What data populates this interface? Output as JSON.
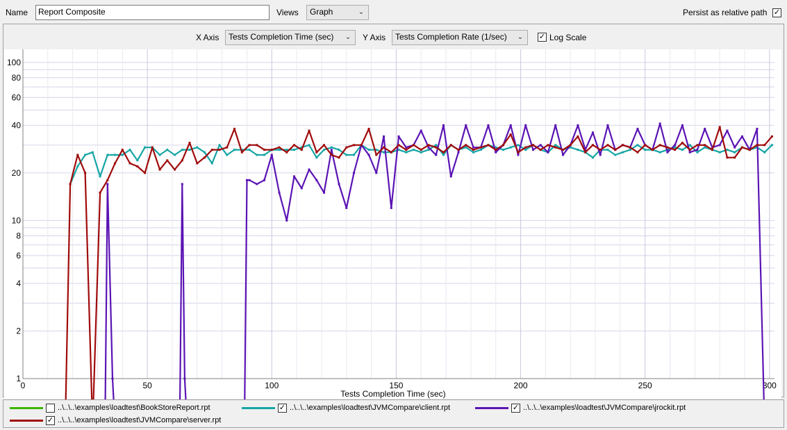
{
  "toolbar": {
    "name_label": "Name",
    "name_value": "Report Composite",
    "views_label": "Views",
    "views_value": "Graph",
    "persist_label": "Persist as relative path",
    "persist_checked": true
  },
  "axis_controls": {
    "x_label": "X Axis",
    "x_value": "Tests Completion Time (sec)",
    "y_label": "Y Axis",
    "y_value": "Tests Completion Rate (1/sec)",
    "log_label": "Log Scale",
    "log_checked": true
  },
  "icons": {
    "dropdown": "chevron-down-icon",
    "checkbox": "checkmark-icon"
  },
  "legend": [
    {
      "name": "..\\..\\..\\examples\\loadtest\\BookStoreReport.rpt",
      "color": "#3cb400",
      "checked": false
    },
    {
      "name": "..\\..\\..\\examples\\loadtest\\JVMCompare\\client.rpt",
      "color": "#16a5a5",
      "checked": true
    },
    {
      "name": "..\\..\\..\\examples\\loadtest\\JVMCompare\\jrockit.rpt",
      "color": "#5a13b4",
      "checked": true
    },
    {
      "name": "..\\..\\..\\examples\\loadtest\\JVMCompare\\server.rpt",
      "color": "#a00a0a",
      "checked": true
    }
  ],
  "chart_data": {
    "type": "line",
    "xlabel": "Tests Completion Time (sec)",
    "ylabel": "",
    "x_scale": "linear",
    "y_scale": "log",
    "xlim": [
      0,
      302
    ],
    "ylim": [
      1,
      115
    ],
    "grid": true,
    "x_ticks": [
      0,
      50,
      100,
      150,
      200,
      250,
      300
    ],
    "y_ticks": [
      1,
      2,
      4,
      6,
      8,
      10,
      20,
      40,
      60,
      80,
      100
    ],
    "legend_position": "bottom",
    "series": [
      {
        "name": "..\\..\\..\\examples\\loadtest\\client.rpt",
        "color": "#16a5a5",
        "x": [
          19,
          22,
          25,
          28,
          31,
          34,
          37,
          40,
          43,
          46,
          49,
          52,
          55,
          58,
          61,
          64,
          67,
          70,
          73,
          76,
          79,
          82,
          85,
          88,
          91,
          94,
          97,
          100,
          103,
          106,
          109,
          112,
          115,
          118,
          121,
          124,
          127,
          130,
          133,
          136,
          139,
          142,
          145,
          148,
          151,
          154,
          157,
          160,
          163,
          166,
          169,
          172,
          175,
          178,
          181,
          184,
          187,
          190,
          193,
          196,
          199,
          202,
          205,
          208,
          211,
          214,
          217,
          220,
          223,
          226,
          229,
          232,
          235,
          238,
          241,
          244,
          247,
          250,
          253,
          256,
          259,
          262,
          265,
          268,
          271,
          274,
          277,
          280,
          283,
          286,
          289,
          292,
          295,
          298,
          301
        ],
        "values": [
          17,
          22,
          26,
          27,
          19,
          26,
          26,
          26,
          28,
          24,
          29,
          29,
          26,
          28,
          26,
          28,
          28,
          29,
          27,
          23,
          30,
          26,
          28,
          28,
          28,
          26,
          26,
          28,
          28,
          28,
          28,
          29,
          30,
          25,
          28,
          29,
          28,
          26,
          26,
          30,
          28,
          28,
          27,
          27,
          28,
          27,
          28,
          27,
          28,
          30,
          26,
          30,
          28,
          29,
          27,
          28,
          30,
          29,
          28,
          29,
          30,
          28,
          30,
          28,
          27,
          30,
          28,
          29,
          28,
          27,
          25,
          28,
          28,
          26,
          27,
          28,
          30,
          28,
          28,
          27,
          28,
          29,
          28,
          30,
          27,
          29,
          28,
          27,
          28,
          27,
          29,
          28,
          29,
          27,
          30
        ]
      },
      {
        "name": "..\\..\\..\\examples\\loadtest\\jrockit.rpt",
        "color": "#5a13b4",
        "x": [
          33,
          34,
          36,
          37,
          63,
          64,
          65,
          66,
          89,
          90,
          91,
          94,
          97,
          100,
          103,
          106,
          109,
          112,
          115,
          118,
          121,
          124,
          127,
          130,
          133,
          136,
          139,
          142,
          145,
          148,
          151,
          154,
          157,
          160,
          163,
          166,
          169,
          172,
          175,
          178,
          181,
          184,
          187,
          190,
          193,
          196,
          199,
          202,
          205,
          208,
          211,
          214,
          217,
          220,
          223,
          226,
          229,
          232,
          235,
          238,
          241,
          244,
          247,
          250,
          253,
          256,
          259,
          262,
          265,
          268,
          271,
          274,
          277,
          280,
          283,
          286,
          289,
          292,
          295,
          298,
          301
        ],
        "values": [
          0.5,
          17,
          1,
          0.5,
          0.5,
          17,
          1,
          0.5,
          0.5,
          18,
          18,
          17,
          18,
          26,
          15,
          10,
          19,
          16,
          21,
          18,
          15,
          28,
          17,
          12,
          20,
          30,
          26,
          20,
          34,
          12,
          34,
          29,
          30,
          37,
          29,
          26,
          40,
          19,
          27,
          40,
          29,
          29,
          40,
          27,
          30,
          40,
          26,
          40,
          28,
          30,
          27,
          40,
          26,
          30,
          40,
          28,
          36,
          26,
          40,
          28,
          30,
          29,
          38,
          30,
          28,
          41,
          27,
          30,
          40,
          27,
          28,
          38,
          29,
          30,
          37,
          29,
          34,
          28,
          38,
          0.5,
          0.5
        ]
      },
      {
        "name": "..\\..\\..\\examples\\loadtest\\server.rpt",
        "color": "#a00a0a",
        "x": [
          17,
          19,
          22,
          25,
          28,
          31,
          34,
          37,
          40,
          43,
          46,
          49,
          52,
          55,
          58,
          61,
          64,
          67,
          70,
          73,
          76,
          79,
          82,
          85,
          88,
          91,
          94,
          97,
          100,
          103,
          106,
          109,
          112,
          115,
          118,
          121,
          124,
          127,
          130,
          133,
          136,
          139,
          142,
          145,
          148,
          151,
          154,
          157,
          160,
          163,
          166,
          169,
          172,
          175,
          178,
          181,
          184,
          187,
          190,
          193,
          196,
          199,
          202,
          205,
          208,
          211,
          214,
          217,
          220,
          223,
          226,
          229,
          232,
          235,
          238,
          241,
          244,
          247,
          250,
          253,
          256,
          259,
          262,
          265,
          268,
          271,
          274,
          277,
          280,
          283,
          286,
          289,
          292,
          295,
          298,
          301
        ],
        "values": [
          0.5,
          17,
          26,
          20,
          0.5,
          15,
          18,
          23,
          28,
          23,
          22,
          20,
          29,
          21,
          24,
          21,
          24,
          31,
          23,
          25,
          28,
          28,
          29,
          38,
          27,
          30,
          30,
          28,
          28,
          29,
          27,
          30,
          28,
          37,
          27,
          30,
          26,
          25,
          29,
          30,
          30,
          38,
          26,
          29,
          27,
          30,
          28,
          30,
          28,
          30,
          29,
          27,
          30,
          28,
          30,
          28,
          29,
          30,
          28,
          30,
          35,
          27,
          29,
          30,
          28,
          30,
          29,
          28,
          30,
          34,
          27,
          30,
          28,
          30,
          28,
          30,
          29,
          27,
          30,
          28,
          30,
          29,
          28,
          31,
          28,
          30,
          30,
          28,
          39,
          25,
          25,
          29,
          28,
          30,
          30,
          34
        ]
      }
    ]
  }
}
